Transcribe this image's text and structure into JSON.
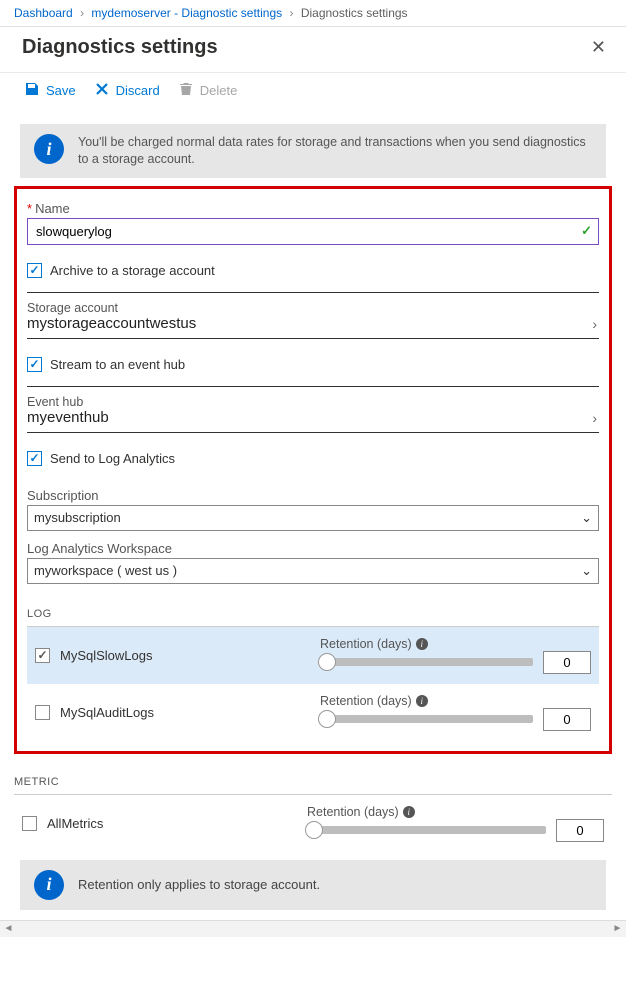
{
  "breadcrumb": {
    "root": "Dashboard",
    "mid": "mydemoserver - Diagnostic settings",
    "leaf": "Diagnostics settings"
  },
  "page_title": "Diagnostics settings",
  "toolbar": {
    "save": "Save",
    "discard": "Discard",
    "delete": "Delete"
  },
  "info_banner": "You'll be charged normal data rates for storage and transactions when you send diagnostics to a storage account.",
  "name": {
    "label": "Name",
    "value": "slowquerylog"
  },
  "archive": {
    "label": "Archive to a storage account",
    "checked": true,
    "storage_label": "Storage account",
    "storage_value": "mystorageaccountwestus"
  },
  "stream": {
    "label": "Stream to an event hub",
    "checked": true,
    "hub_label": "Event hub",
    "hub_value": "myeventhub"
  },
  "log_analytics": {
    "label": "Send to Log Analytics",
    "checked": true,
    "subscription_label": "Subscription",
    "subscription_value": "mysubscription",
    "workspace_label": "Log Analytics Workspace",
    "workspace_value": "myworkspace ( west us )"
  },
  "sections": {
    "log": "LOG",
    "metric": "METRIC"
  },
  "retention_label": "Retention (days)",
  "log_categories": [
    {
      "name": "MySqlSlowLogs",
      "checked": true,
      "retention": "0"
    },
    {
      "name": "MySqlAuditLogs",
      "checked": false,
      "retention": "0"
    }
  ],
  "metric_categories": [
    {
      "name": "AllMetrics",
      "checked": false,
      "retention": "0"
    }
  ],
  "footer_banner": "Retention only applies to storage account."
}
